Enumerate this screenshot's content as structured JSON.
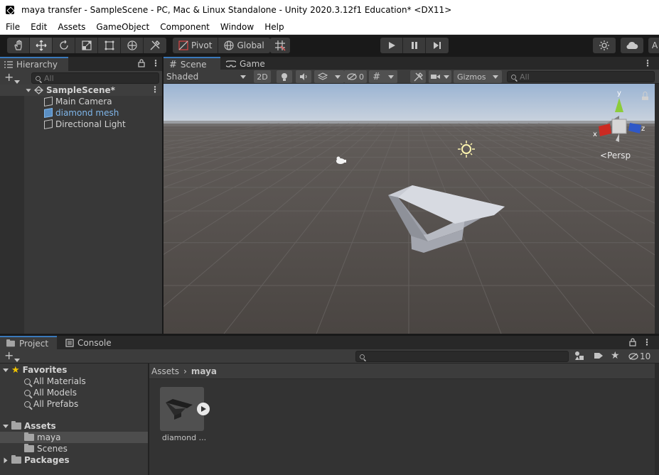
{
  "window": {
    "title": "maya transfer - SampleScene - PC, Mac & Linux Standalone - Unity 2020.3.12f1 Education* <DX11>"
  },
  "menu": [
    "File",
    "Edit",
    "Assets",
    "GameObject",
    "Component",
    "Window",
    "Help"
  ],
  "toolbar": {
    "pivot_label": "Pivot",
    "global_label": "Global",
    "edge_label": "A"
  },
  "hierarchy": {
    "tab_label": "Hierarchy",
    "search_placeholder": "All",
    "scene_name": "SampleScene*",
    "items": [
      "Main Camera",
      "diamond mesh",
      "Directional Light"
    ]
  },
  "scene_view": {
    "tab_scene": "Scene",
    "tab_game": "Game",
    "shading_mode": "Shaded",
    "mode_2d": "2D",
    "hidden_count": "0",
    "gizmos_label": "Gizmos",
    "search_placeholder": "All",
    "persp_label": "Persp",
    "axis_labels": {
      "x": "x",
      "y": "y",
      "z": "z"
    },
    "colors": {
      "sky": "#b9c9dc",
      "ground": "#4d4845",
      "mesh": "#a9acb5"
    }
  },
  "project": {
    "tab_project": "Project",
    "tab_console": "Console",
    "hidden_count": "10",
    "favorites_label": "Favorites",
    "favorites": [
      "All Materials",
      "All Models",
      "All Prefabs"
    ],
    "assets_label": "Assets",
    "asset_folders": [
      "maya",
      "Scenes"
    ],
    "packages_label": "Packages",
    "breadcrumb": [
      "Assets",
      "maya"
    ],
    "asset_items": [
      {
        "name": "diamond ..."
      }
    ]
  }
}
